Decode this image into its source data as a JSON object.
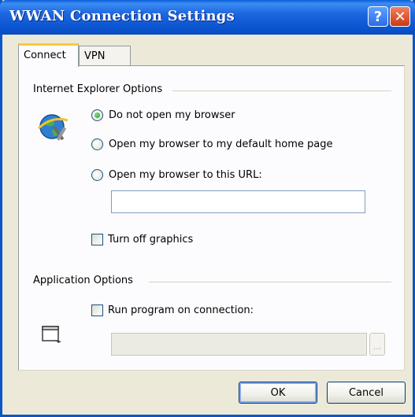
{
  "window": {
    "title": "WWAN Connection Settings",
    "help_glyph": "?",
    "close_glyph": "✕"
  },
  "tabs": [
    {
      "label": "Connect",
      "active": true
    },
    {
      "label": "VPN",
      "active": false
    }
  ],
  "ie_options": {
    "group_label": "Internet Explorer Options",
    "icon": "internet-explorer-settings-icon",
    "radios": [
      {
        "label": "Do not open my browser",
        "checked": true
      },
      {
        "label": "Open my browser to my default home page",
        "checked": false
      },
      {
        "label": "Open my browser to this URL:",
        "checked": false
      }
    ],
    "url_value": "",
    "turn_off_graphics": {
      "label": "Turn off graphics",
      "checked": false
    }
  },
  "app_options": {
    "group_label": "Application Options",
    "icon": "application-window-icon",
    "run_program": {
      "label": "Run program on connection:",
      "checked": false
    },
    "program_value": "",
    "browse_label": "..."
  },
  "buttons": {
    "ok": "OK",
    "cancel": "Cancel"
  },
  "colors": {
    "title_bar": "#0a55d0",
    "close_button": "#c83a14",
    "active_tab_accent": "#ffc83c",
    "radio_selected": "#21a121"
  }
}
